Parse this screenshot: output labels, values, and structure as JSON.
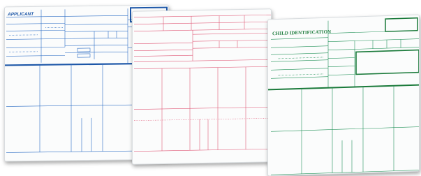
{
  "cards": {
    "blue": {
      "heading": "APPLICANT",
      "color": "#2b6cc4"
    },
    "red": {
      "color": "#e05a78"
    },
    "green": {
      "heading": "CHILD IDENTIFICATION",
      "color": "#24935a"
    }
  }
}
